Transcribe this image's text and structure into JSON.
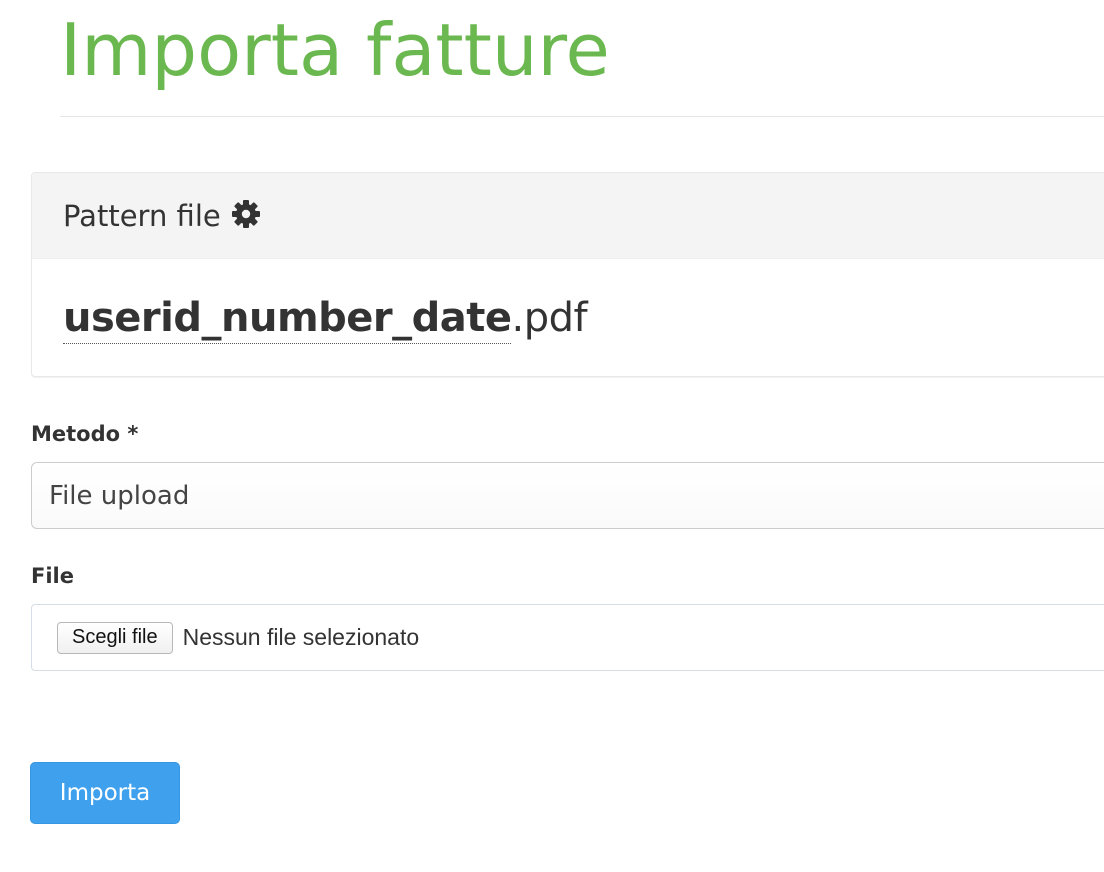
{
  "header": {
    "title": "Importa fatture"
  },
  "pattern_panel": {
    "heading": "Pattern file",
    "heading_icon": "gear-icon",
    "pattern_name": "userid_number_date",
    "pattern_extension": ".pdf"
  },
  "form": {
    "method": {
      "label": "Metodo *",
      "selected_value": "File upload"
    },
    "file": {
      "label": "File",
      "choose_button": "Scegli file",
      "status": "Nessun file selezionato"
    },
    "submit_label": "Importa"
  },
  "colors": {
    "title": "#6ab84f",
    "primary_button": "#3fa1ee",
    "panel_heading_bg": "#f4f4f4"
  }
}
